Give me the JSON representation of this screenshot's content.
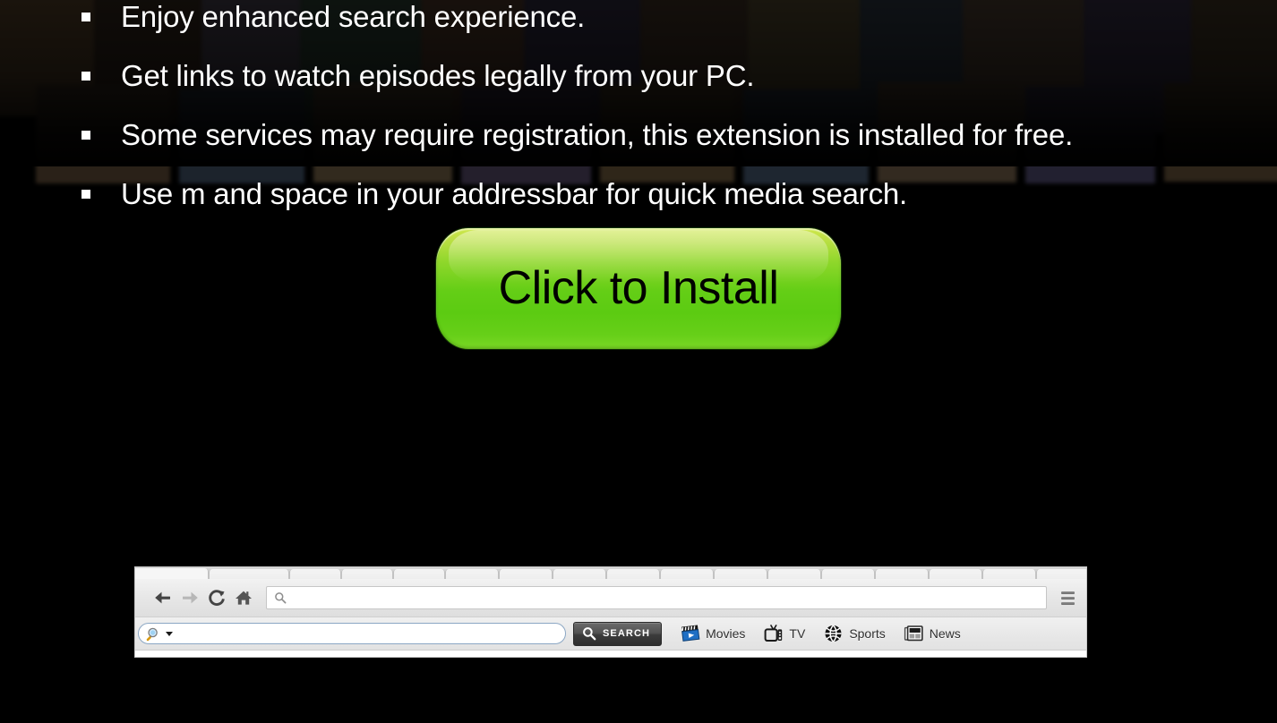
{
  "page": {
    "background_color": "#000000",
    "text_color": "#ffffff"
  },
  "bullets": [
    {
      "text": "Enjoy enhanced search experience."
    },
    {
      "text": "Get links to watch episodes legally from your PC."
    },
    {
      "text": "Some services may require registration, this extension is installed for free."
    },
    {
      "text": "Use m and space in your addressbar for quick media search."
    }
  ],
  "install_button": {
    "label": "Click to Install",
    "color_top": "#cfe84b",
    "color_bottom": "#5ccb12",
    "text_color": "#000000"
  },
  "browser_mockup": {
    "nav": {
      "back_icon": "arrow-left-icon",
      "forward_icon": "arrow-right-icon",
      "reload_icon": "reload-icon",
      "home_icon": "home-icon",
      "menu_icon": "hamburger-menu-icon",
      "url_value": "",
      "url_placeholder": "",
      "url_search_icon": "search-icon"
    },
    "extension_toolbar": {
      "search_box": {
        "value": "",
        "placeholder": "",
        "icon": "magnifier-icon",
        "dropdown_icon": "caret-down-icon",
        "border_color": "#8ba7c4"
      },
      "search_button": {
        "label": "SEARCH",
        "icon": "search-icon",
        "background": "#3b3b3b",
        "text_color": "#ffffff"
      },
      "categories": [
        {
          "label": "Movies",
          "icon": "clapperboard-icon"
        },
        {
          "label": "TV",
          "icon": "television-icon"
        },
        {
          "label": "Sports",
          "icon": "basketball-icon"
        },
        {
          "label": "News",
          "icon": "newspaper-icon"
        }
      ]
    }
  }
}
